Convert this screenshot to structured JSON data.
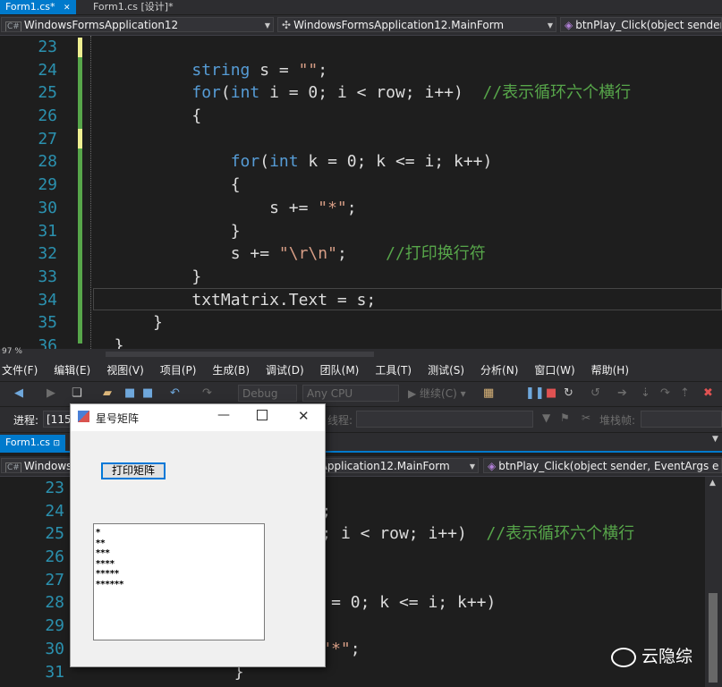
{
  "top_editor": {
    "tabs": [
      {
        "label": "Form1.cs*"
      },
      {
        "label": "Form1.cs [设计]*"
      }
    ],
    "nav": {
      "project": "WindowsFormsApplication12",
      "class": "WindowsFormsApplication12.MainForm",
      "member": "btnPlay_Click(object sender,"
    },
    "line_numbers": [
      "23",
      "24",
      "25",
      "26",
      "27",
      "28",
      "29",
      "30",
      "31",
      "32",
      "33",
      "34",
      "35",
      "36"
    ],
    "zoom": "97 %"
  },
  "menu": [
    "文件(F)",
    "编辑(E)",
    "视图(V)",
    "项目(P)",
    "生成(B)",
    "调试(D)",
    "团队(M)",
    "工具(T)",
    "测试(S)",
    "分析(N)",
    "窗口(W)",
    "帮助(H)"
  ],
  "toolbar": {
    "config": "Debug",
    "platform": "Any CPU",
    "continue": "继续(C)"
  },
  "debug_bar": {
    "process_label": "进程:",
    "process_value": "[115",
    "thread_label": "线程:",
    "stack_label": "堆栈帧:"
  },
  "bottom_editor": {
    "tab": "Form1.cs",
    "nav": {
      "project": "WindowsF",
      "class": "rmsApplication12.MainForm",
      "member": "btnPlay_Click(object sender, EventArgs e"
    },
    "line_numbers": [
      "23",
      "24",
      "25",
      "26",
      "27",
      "28",
      "29",
      "30",
      "31"
    ]
  },
  "winform": {
    "title": "星号矩阵",
    "button": "打印矩阵",
    "output_lines": [
      "*",
      "**",
      "***",
      "****",
      "*****",
      "******"
    ]
  },
  "watermark": "云隐综"
}
